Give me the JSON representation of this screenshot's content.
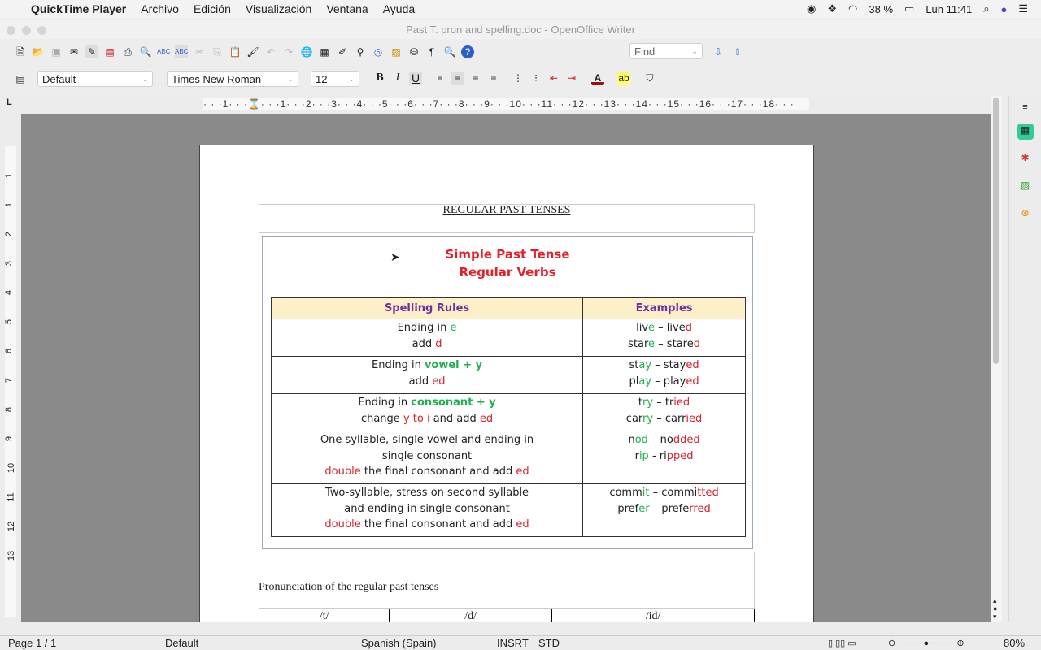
{
  "menubar": {
    "app": "QuickTime Player",
    "items": [
      "Archivo",
      "Edición",
      "Visualización",
      "Ventana",
      "Ayuda"
    ],
    "battery": "38 %",
    "clock": "Lun 11:41"
  },
  "window": {
    "title": "Past T. pron and spelling.doc - OpenOffice Writer"
  },
  "toolbar": {
    "find_placeholder": "Find",
    "style": "Default",
    "font": "Times New Roman",
    "size": "12"
  },
  "ruler": {
    "text": "· · ·1· · ·⌛· · ·1· · ·2· · ·3· · ·4· · ·5· · ·6· · ·7· · ·8· · ·9· · ·10· · ·11· · ·12· · ·13· · ·14· · ·15· · ·16· · ·17· · ·18· · ·",
    "vnums": [
      "1",
      "1",
      "2",
      "3",
      "4",
      "5",
      "6",
      "7",
      "8",
      "9",
      "10",
      "11",
      "12",
      "13"
    ]
  },
  "doc": {
    "heading": "REGULAR PAST TENSES",
    "title1": "Simple Past Tense",
    "title2": "Regular Verbs",
    "headers": [
      "Spelling Rules",
      "Examples"
    ],
    "rows": [
      {
        "rule": [
          [
            [
              "Ending in ",
              "k"
            ],
            [
              "e",
              "g"
            ]
          ],
          [
            [
              "add ",
              "k"
            ],
            [
              "d",
              "r"
            ]
          ]
        ],
        "ex": [
          [
            [
              "liv",
              "k"
            ],
            [
              "e",
              "g"
            ],
            [
              " – live",
              "k"
            ],
            [
              "d",
              "r"
            ]
          ],
          [
            [
              "star",
              "k"
            ],
            [
              "e",
              "g"
            ],
            [
              " – stare",
              "k"
            ],
            [
              "d",
              "r"
            ]
          ]
        ]
      },
      {
        "rule": [
          [
            [
              "Ending in ",
              "k"
            ],
            [
              "vowel + y",
              "gb"
            ]
          ],
          [
            [
              "add ",
              "k"
            ],
            [
              "ed",
              "r"
            ]
          ]
        ],
        "ex": [
          [
            [
              "st",
              "k"
            ],
            [
              "ay",
              "g"
            ],
            [
              " – stay",
              "k"
            ],
            [
              "ed",
              "r"
            ]
          ],
          [
            [
              "pl",
              "k"
            ],
            [
              "ay",
              "g"
            ],
            [
              " – play",
              "k"
            ],
            [
              "ed",
              "r"
            ]
          ]
        ]
      },
      {
        "rule": [
          [
            [
              "Ending in ",
              "k"
            ],
            [
              "consonant + y",
              "gb"
            ]
          ],
          [
            [
              "change ",
              "k"
            ],
            [
              "y to i",
              "r"
            ],
            [
              " and add ",
              "k"
            ],
            [
              "ed",
              "r"
            ]
          ]
        ],
        "ex": [
          [
            [
              "t",
              "k"
            ],
            [
              "ry",
              "g"
            ],
            [
              " – tr",
              "k"
            ],
            [
              "ied",
              "r"
            ]
          ],
          [
            [
              "car",
              "k"
            ],
            [
              "ry",
              "g"
            ],
            [
              " – carr",
              "k"
            ],
            [
              "ied",
              "r"
            ]
          ]
        ]
      },
      {
        "rule": [
          [
            [
              "One syllable, single vowel and ending in",
              "k"
            ]
          ],
          [
            [
              "single consonant",
              "k"
            ]
          ],
          [
            [
              "double",
              "r"
            ],
            [
              " the final consonant and add ",
              "k"
            ],
            [
              "ed",
              "r"
            ]
          ]
        ],
        "ex": [
          [
            [
              "n",
              "k"
            ],
            [
              "od",
              "g"
            ],
            [
              " – no",
              "k"
            ],
            [
              "dded",
              "r"
            ]
          ],
          [
            [
              "r",
              "k"
            ],
            [
              "ip",
              "g"
            ],
            [
              " - ri",
              "k"
            ],
            [
              "pped",
              "r"
            ]
          ]
        ]
      },
      {
        "rule": [
          [
            [
              "Two-syllable, stress on second syllable",
              "k"
            ]
          ],
          [
            [
              "and ending in single consonant",
              "k"
            ]
          ],
          [
            [
              "double",
              "r"
            ],
            [
              " the final consonant and add ",
              "k"
            ],
            [
              "ed",
              "r"
            ]
          ]
        ],
        "ex": [
          [
            [
              "comm",
              "k"
            ],
            [
              "it",
              "g"
            ],
            [
              " – commi",
              "k"
            ],
            [
              "tted",
              "r"
            ]
          ],
          [
            [
              "pref",
              "k"
            ],
            [
              "er",
              "g"
            ],
            [
              " – prefe",
              "k"
            ],
            [
              "rred",
              "r"
            ]
          ]
        ]
      }
    ],
    "pron_heading": "Pronunciation of the regular past tenses",
    "pron_cols": [
      "/t/",
      "/d/",
      "/id/"
    ]
  },
  "status": {
    "page": "Page 1 / 1",
    "style": "Default",
    "lang": "Spanish (Spain)",
    "mode": "INSRT",
    "sel": "STD",
    "zoom": "80%"
  }
}
